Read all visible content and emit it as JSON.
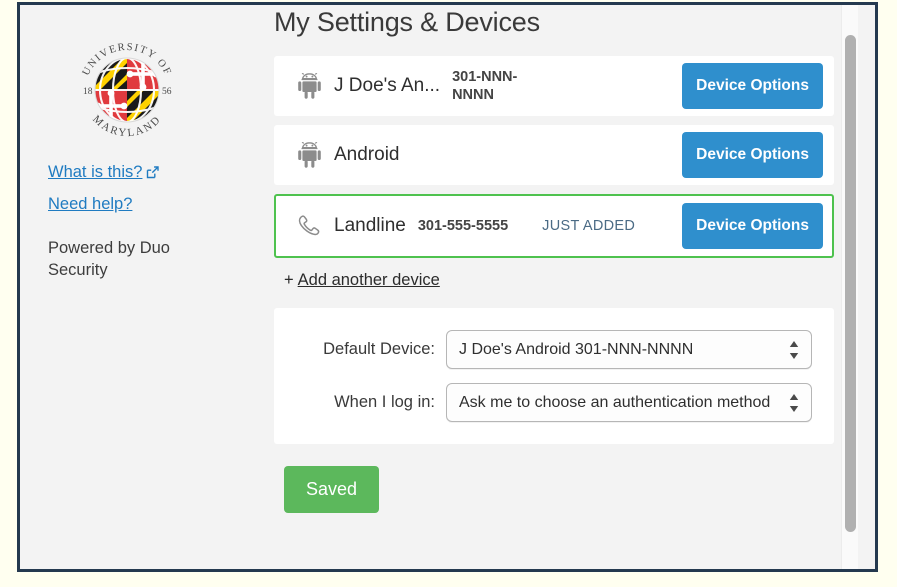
{
  "window": {
    "title": "My Settings & Devices"
  },
  "sidebar": {
    "logo_alt": "University of Maryland seal",
    "logo_text": {
      "top_arc": "UNIVERSITY OF",
      "bottom_arc": "MARYLAND",
      "year_left": "18",
      "year_right": "56"
    },
    "links": [
      {
        "label": "What is this?",
        "icon": "external-link-icon",
        "has_external_icon": true
      },
      {
        "label": "Need help?",
        "icon": "",
        "has_external_icon": false
      }
    ],
    "powered_by": "Powered by Duo Security"
  },
  "main": {
    "title": "My Settings & Devices",
    "devices": [
      {
        "icon": "android-icon",
        "name": "J Doe's An...",
        "phone": "301-NNN-NNNN",
        "badge": "",
        "button_label": "Device Options",
        "highlighted": false
      },
      {
        "icon": "android-icon",
        "name": "Android",
        "phone": "",
        "badge": "",
        "button_label": "Device Options",
        "highlighted": false
      },
      {
        "icon": "phone-handset-icon",
        "name": "Landline",
        "phone": "301-555-5555",
        "badge": "JUST ADDED",
        "button_label": "Device Options",
        "highlighted": true
      }
    ],
    "add_device": {
      "plus": "+",
      "label": "Add another device"
    },
    "settings": [
      {
        "label": "Default Device:",
        "value": "J Doe's Android  301-NNN-NNNN"
      },
      {
        "label": "When I log in:",
        "value": "Ask me to choose an authentication method"
      }
    ],
    "save_button": "Saved"
  },
  "colors": {
    "accent_blue": "#2f8fcd",
    "save_green": "#5cb85c",
    "highlight_green": "#4ec24e",
    "link_blue": "#1f7bc1",
    "badge_blue": "#4b6b85",
    "page_bg": "#f3f3f3",
    "outer_bg": "#fffff0",
    "frame_border": "#24394f"
  }
}
